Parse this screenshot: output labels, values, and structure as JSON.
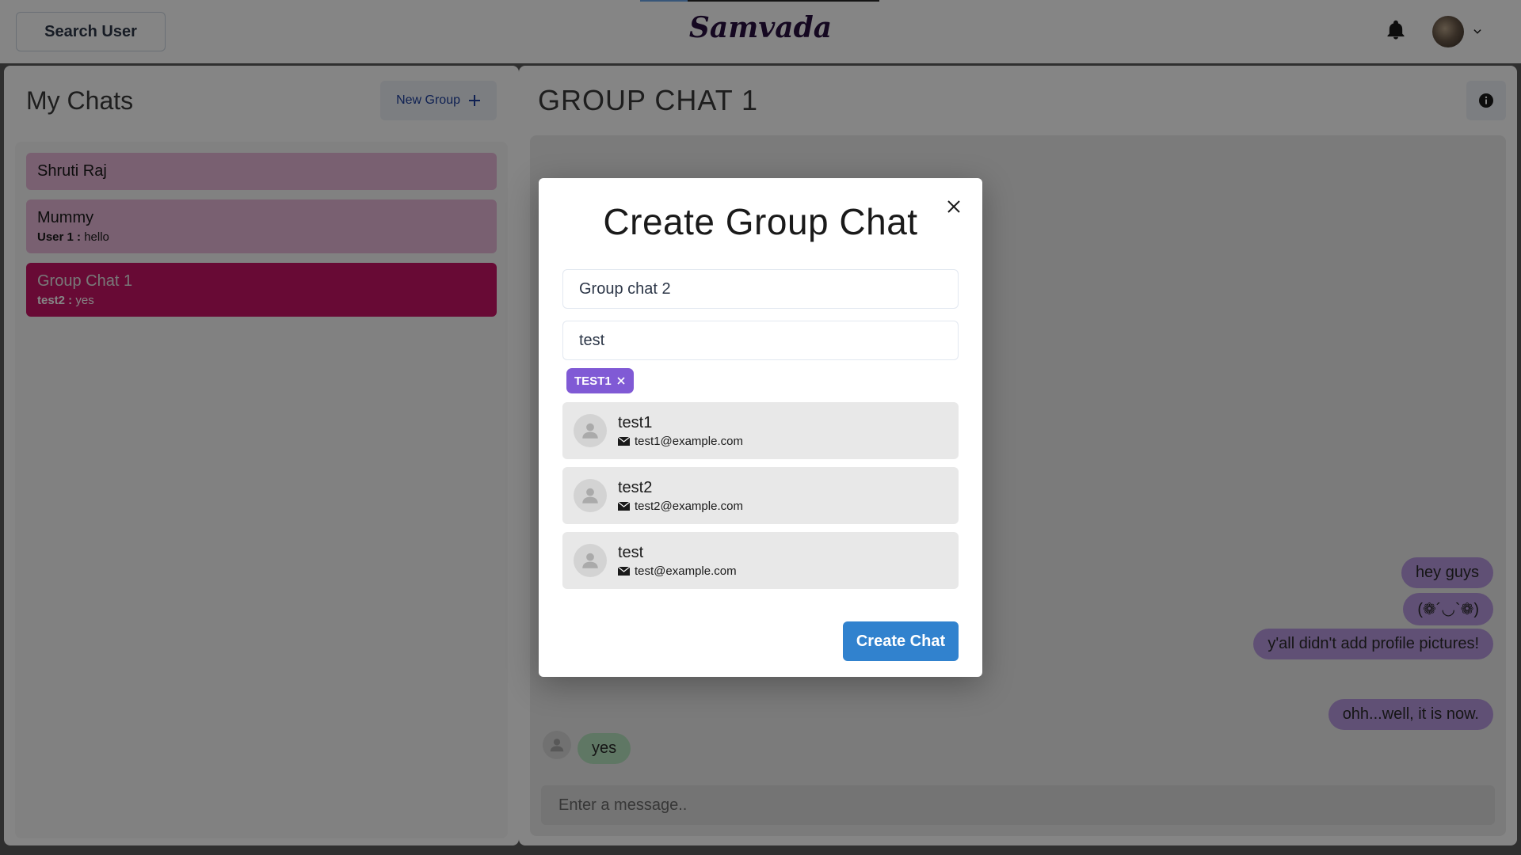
{
  "header": {
    "search_label": "Search User",
    "brand": "Samvada",
    "bell_icon": "bell-icon",
    "avatar_icon": "user-avatar",
    "chevron_icon": "chevron-down-icon"
  },
  "sidebar": {
    "title": "My Chats",
    "new_group_label": "New Group",
    "chats": [
      {
        "name": "Shruti Raj",
        "sender": "",
        "message": ""
      },
      {
        "name": "Mummy",
        "sender": "User 1 :",
        "message": "hello"
      },
      {
        "name": "Group Chat 1",
        "sender": "test2 :",
        "message": "yes"
      }
    ]
  },
  "chat": {
    "title": "GROUP CHAT 1",
    "messages": [
      {
        "text": "hey guys",
        "mine": true
      },
      {
        "text": "(❁´◡`❁)",
        "mine": true
      },
      {
        "text": "y'all didn't add profile pictures!",
        "mine": true
      },
      {
        "text": "ohh...well, it is now.",
        "mine": true
      },
      {
        "text": "yes",
        "mine": false
      }
    ],
    "input_placeholder": "Enter a message.."
  },
  "modal": {
    "title": "Create Group Chat",
    "chat_name_value": "Group chat 2",
    "search_value": "test",
    "selected_tag": "TEST1",
    "results": [
      {
        "name": "test1",
        "email": "test1@example.com"
      },
      {
        "name": "test2",
        "email": "test2@example.com"
      },
      {
        "name": "test",
        "email": "test@example.com"
      }
    ],
    "create_label": "Create Chat"
  },
  "colors": {
    "accent_pink": "#c71566",
    "tag_purple": "#805ad5",
    "button_blue": "#3182ce",
    "bubble_mine": "#b99ae0",
    "bubble_theirs": "#b7e4c0"
  }
}
